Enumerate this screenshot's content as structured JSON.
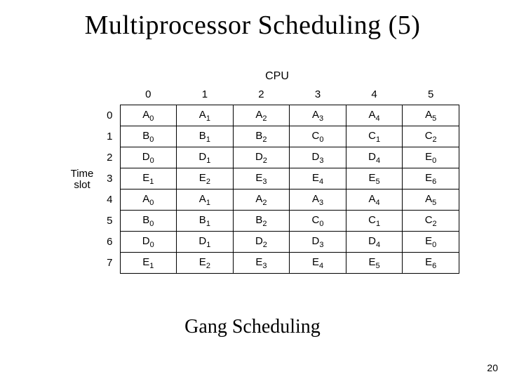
{
  "title": "Multiprocessor Scheduling (5)",
  "caption": "Gang Scheduling",
  "page_number": "20",
  "labels": {
    "cpu": "CPU",
    "time_slot_line1": "Time",
    "time_slot_line2": "slot"
  },
  "chart_data": {
    "type": "table",
    "title": "Gang Scheduling time-slot × CPU assignment",
    "xlabel": "CPU",
    "ylabel": "Time slot",
    "col_headers": [
      "0",
      "1",
      "2",
      "3",
      "4",
      "5"
    ],
    "row_headers": [
      "0",
      "1",
      "2",
      "3",
      "4",
      "5",
      "6",
      "7"
    ],
    "rows": [
      [
        {
          "l": "A",
          "s": "0"
        },
        {
          "l": "A",
          "s": "1"
        },
        {
          "l": "A",
          "s": "2"
        },
        {
          "l": "A",
          "s": "3"
        },
        {
          "l": "A",
          "s": "4"
        },
        {
          "l": "A",
          "s": "5"
        }
      ],
      [
        {
          "l": "B",
          "s": "0"
        },
        {
          "l": "B",
          "s": "1"
        },
        {
          "l": "B",
          "s": "2"
        },
        {
          "l": "C",
          "s": "0"
        },
        {
          "l": "C",
          "s": "1"
        },
        {
          "l": "C",
          "s": "2"
        }
      ],
      [
        {
          "l": "D",
          "s": "0"
        },
        {
          "l": "D",
          "s": "1"
        },
        {
          "l": "D",
          "s": "2"
        },
        {
          "l": "D",
          "s": "3"
        },
        {
          "l": "D",
          "s": "4"
        },
        {
          "l": "E",
          "s": "0"
        }
      ],
      [
        {
          "l": "E",
          "s": "1"
        },
        {
          "l": "E",
          "s": "2"
        },
        {
          "l": "E",
          "s": "3"
        },
        {
          "l": "E",
          "s": "4"
        },
        {
          "l": "E",
          "s": "5"
        },
        {
          "l": "E",
          "s": "6"
        }
      ],
      [
        {
          "l": "A",
          "s": "0"
        },
        {
          "l": "A",
          "s": "1"
        },
        {
          "l": "A",
          "s": "2"
        },
        {
          "l": "A",
          "s": "3"
        },
        {
          "l": "A",
          "s": "4"
        },
        {
          "l": "A",
          "s": "5"
        }
      ],
      [
        {
          "l": "B",
          "s": "0"
        },
        {
          "l": "B",
          "s": "1"
        },
        {
          "l": "B",
          "s": "2"
        },
        {
          "l": "C",
          "s": "0"
        },
        {
          "l": "C",
          "s": "1"
        },
        {
          "l": "C",
          "s": "2"
        }
      ],
      [
        {
          "l": "D",
          "s": "0"
        },
        {
          "l": "D",
          "s": "1"
        },
        {
          "l": "D",
          "s": "2"
        },
        {
          "l": "D",
          "s": "3"
        },
        {
          "l": "D",
          "s": "4"
        },
        {
          "l": "E",
          "s": "0"
        }
      ],
      [
        {
          "l": "E",
          "s": "1"
        },
        {
          "l": "E",
          "s": "2"
        },
        {
          "l": "E",
          "s": "3"
        },
        {
          "l": "E",
          "s": "4"
        },
        {
          "l": "E",
          "s": "5"
        },
        {
          "l": "E",
          "s": "6"
        }
      ]
    ]
  }
}
